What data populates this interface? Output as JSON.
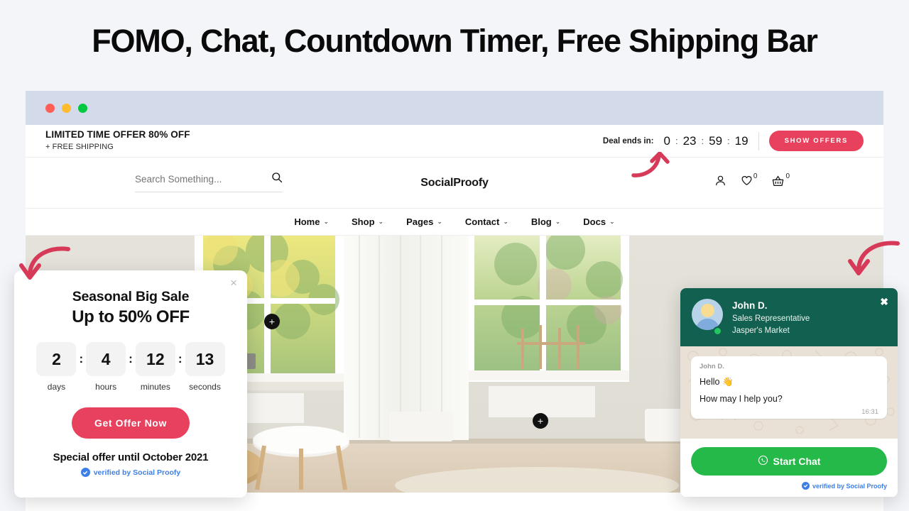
{
  "headline": "FOMO, Chat, Countdown Timer, Free Shipping Bar",
  "browser": {
    "traffic_lights": [
      "close",
      "minimize",
      "maximize"
    ],
    "colors": {
      "red": "#ff5f57",
      "yellow": "#febc2e",
      "green": "#00c840",
      "bar": "#d3daea"
    }
  },
  "announcement_bar": {
    "title": "LIMITED TIME OFFER 80% OFF",
    "subtitle": "+ FREE SHIPPING",
    "deal_label": "Deal ends in:",
    "timer": {
      "days": "0",
      "hours": "23",
      "minutes": "59",
      "seconds": "19",
      "separator": ":"
    },
    "cta_label": "SHOW OFFERS",
    "cta_color": "#e8415e"
  },
  "header": {
    "search_placeholder": "Search Something...",
    "search_value": "",
    "logo": "SocialProofy",
    "icons": [
      {
        "name": "account-icon",
        "count": ""
      },
      {
        "name": "wishlist-heart-icon",
        "count": "0"
      },
      {
        "name": "cart-basket-icon",
        "count": "0"
      }
    ]
  },
  "nav": {
    "items": [
      {
        "label": "Home",
        "caret": "⌄"
      },
      {
        "label": "Shop",
        "caret": "⌄"
      },
      {
        "label": "Pages",
        "caret": "⌄"
      },
      {
        "label": "Contact",
        "caret": "⌄"
      },
      {
        "label": "Blog",
        "caret": "⌄"
      },
      {
        "label": "Docs",
        "caret": "⌄"
      }
    ]
  },
  "hero": {
    "hotspots": [
      {
        "label": "+"
      },
      {
        "label": "+"
      }
    ]
  },
  "countdown_popup": {
    "close": "×",
    "title": "Seasonal Big Sale",
    "subtitle": "Up to 50% OFF",
    "timer": [
      {
        "value": "2",
        "label": "days"
      },
      {
        "value": "4",
        "label": "hours"
      },
      {
        "value": "12",
        "label": "minutes"
      },
      {
        "value": "13",
        "label": "seconds"
      }
    ],
    "separator": ":",
    "cta_label": "Get Offer Now",
    "cta_color": "#e8415e",
    "footer": "Special offer until October 2021",
    "verified": "verified by Social Proofy",
    "verified_color": "#3d7fe8"
  },
  "chat_widget": {
    "close": "✖",
    "agent_name": "John D.",
    "agent_role": "Sales Representative",
    "agent_company": "Jasper's Market",
    "header_color": "#12604f",
    "online": true,
    "message": {
      "sender": "John D.",
      "line1": "Hello 👋",
      "line2": "How may I help you?",
      "time": "16:31"
    },
    "cta_label": "Start Chat",
    "cta_color": "#25b94a",
    "verified": "verified by Social Proofy"
  },
  "annotations": {
    "arrow_color": "#d63a58",
    "arrows": [
      "arrow-to-countdown-popup",
      "arrow-to-chat-widget",
      "arrow-to-deal-timer"
    ]
  }
}
